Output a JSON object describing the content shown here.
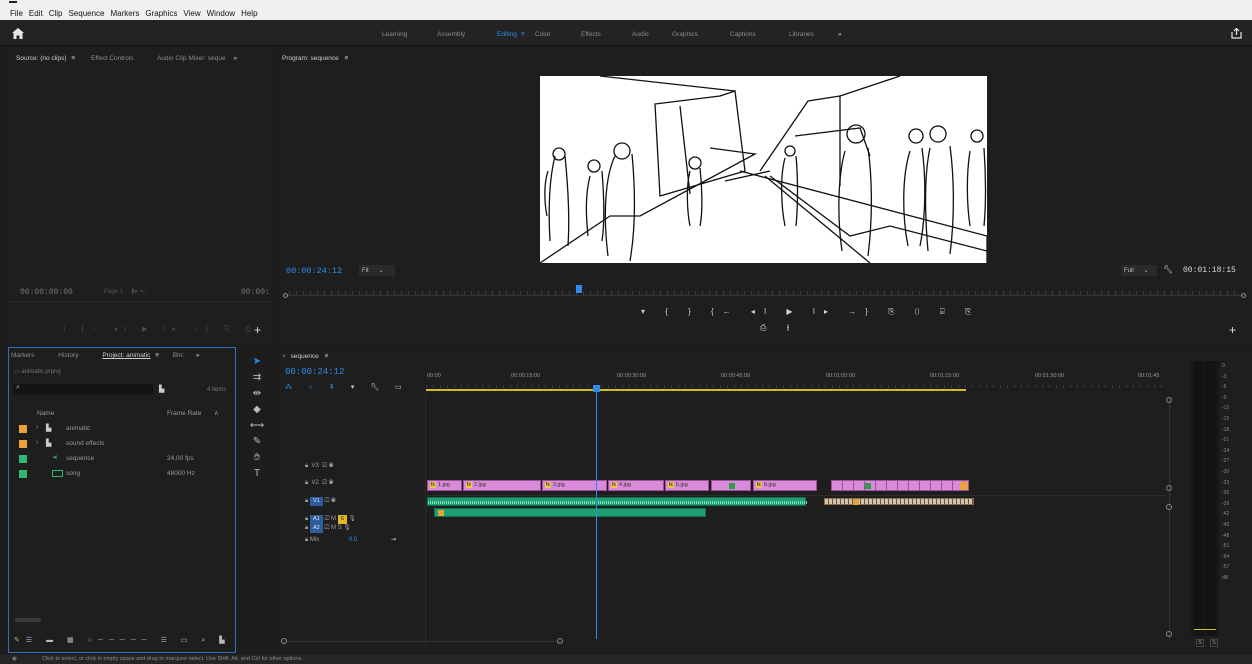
{
  "menu": [
    "File",
    "Edit",
    "Clip",
    "Sequence",
    "Markers",
    "Graphics",
    "View",
    "Window",
    "Help"
  ],
  "workspaces": {
    "tabs": [
      "Learning",
      "Assembly",
      "Editing",
      "Color",
      "Effects",
      "Audio",
      "Graphics",
      "Captions",
      "Libraries"
    ],
    "active": "Editing",
    "more": "»"
  },
  "source": {
    "tabs": [
      "Source: (no clips)",
      "Effect Controls",
      "Audio Clip Mixer: seque"
    ],
    "menu_glyph": "≡",
    "more": "»",
    "timecode_in": "00:00:00:00",
    "page": "Page 1",
    "timecode_out": "00:00:"
  },
  "program": {
    "title": "Program: sequence",
    "menu_glyph": "≡",
    "timecode": "00:00:24:12",
    "fit": "Fit",
    "quality": "Full",
    "duration": "00:01:18:15",
    "playhead_fraction": 0.305
  },
  "project": {
    "tabs": [
      "Markers",
      "History",
      "Project: animatic",
      "Bin:"
    ],
    "menu_glyph": "≡",
    "more": "»",
    "file": "animatic.prproj",
    "item_count": "4 items",
    "columns": [
      "Name",
      "Frame Rate"
    ],
    "sort_glyph": "∧",
    "items": [
      {
        "name": "animatic",
        "rate": "",
        "color": "#e8a33a",
        "kind": "folder"
      },
      {
        "name": "sound effects",
        "rate": "",
        "color": "#e8a33a",
        "kind": "folder"
      },
      {
        "name": "sequence",
        "rate": "24.00 fps",
        "color": "#2eb872",
        "kind": "sequence"
      },
      {
        "name": "song",
        "rate": "48000 Hz",
        "color": "#2eb872",
        "kind": "audio"
      }
    ]
  },
  "timeline": {
    "tab": "sequence",
    "menu_glyph": "≡",
    "timecode": "00:00:24:12",
    "ruler": [
      "00:00",
      "00:00:15:00",
      "00:00:30:00",
      "00:00:45:00",
      "00:01:00:00",
      "00:01:15:00",
      "00:01:30:00",
      "00:01:45"
    ],
    "video_tracks": [
      "V3",
      "V2",
      "V1"
    ],
    "audio_tracks": [
      "A1",
      "A2"
    ],
    "mix_label": "Mix",
    "mix_value": "0.0",
    "clips": [
      "1.jpg",
      "2.jpg",
      "3.jpg",
      "4.jpg",
      "5.jpg",
      "8.jpg"
    ],
    "fx_label": "fx",
    "m_label": "M",
    "s_label": "S"
  },
  "meter": {
    "scale": [
      "0",
      "-3",
      "-6",
      "-9",
      "-12",
      "-15",
      "-18",
      "-21",
      "-24",
      "-27",
      "-30",
      "-33",
      "-36",
      "-39",
      "-42",
      "-45",
      "-48",
      "-51",
      "-54",
      "-57",
      "dB"
    ],
    "solo_left": "S",
    "solo_right": "S"
  },
  "status": "Click to select, or click in empty space and drag to marquee select. Use Shift, Alt, and Ctrl for other options.",
  "colors": {
    "accent": "#2d8ceb",
    "clip": "#d98ad9",
    "audio": "#22a67a"
  }
}
